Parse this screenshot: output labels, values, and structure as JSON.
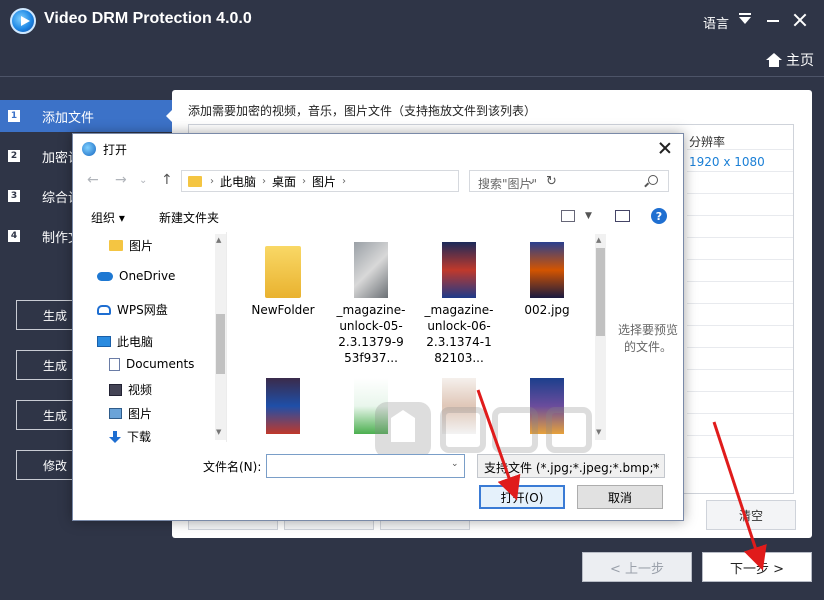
{
  "app": {
    "title": "Video DRM Protection 4.0.0",
    "lang_label": "语言",
    "home_label": "主页"
  },
  "sidebar": {
    "steps": [
      {
        "num": "1",
        "label": "添加文件"
      },
      {
        "num": "2",
        "label": "加密设"
      },
      {
        "num": "3",
        "label": "综合设"
      },
      {
        "num": "4",
        "label": "制作文"
      }
    ],
    "buttons": [
      "生成",
      "生成",
      "生成",
      "修改"
    ]
  },
  "main": {
    "hint": "添加需要加密的视频，音乐，图片文件（支持拖放文件到该列表）",
    "table": {
      "col_resolution": "分辨率",
      "row_resolution": "1920 x 1080"
    },
    "clear_label": "清空",
    "prev_label": "< 上一步",
    "next_label": "下一步 >"
  },
  "dialog": {
    "title": "打开",
    "breadcrumb": [
      "此电脑",
      "桌面",
      "图片"
    ],
    "search_placeholder": "搜索\"图片\"",
    "organize_label": "组织 ▾",
    "new_folder_label": "新建文件夹",
    "help_label": "?",
    "nav_items": [
      "图片",
      "OneDrive",
      "WPS网盘",
      "此电脑",
      "Documents",
      "视频",
      "图片",
      "下载"
    ],
    "files": [
      {
        "name": "NewFolder",
        "kind": "folder"
      },
      {
        "name": "_magazine-unlock-05-2.3.1379-953f937...",
        "kind": "image"
      },
      {
        "name": "_magazine-unlock-06-2.3.1374-182103...",
        "kind": "image"
      },
      {
        "name": "002.jpg",
        "kind": "image"
      },
      {
        "name": "",
        "kind": "image"
      },
      {
        "name": "",
        "kind": "image"
      },
      {
        "name": "",
        "kind": "image"
      },
      {
        "name": "",
        "kind": "image"
      }
    ],
    "preview_hint": "选择要预览的文件。",
    "filename_label": "文件名(N):",
    "filename_value": "",
    "filter_value": "支持文件 (*.jpg;*.jpeg;*.bmp;*",
    "open_label": "打开(O)",
    "cancel_label": "取消"
  },
  "colors": {
    "app_bg": "#2f3547",
    "accent": "#3c72c8",
    "arrow": "#e01b1b"
  }
}
